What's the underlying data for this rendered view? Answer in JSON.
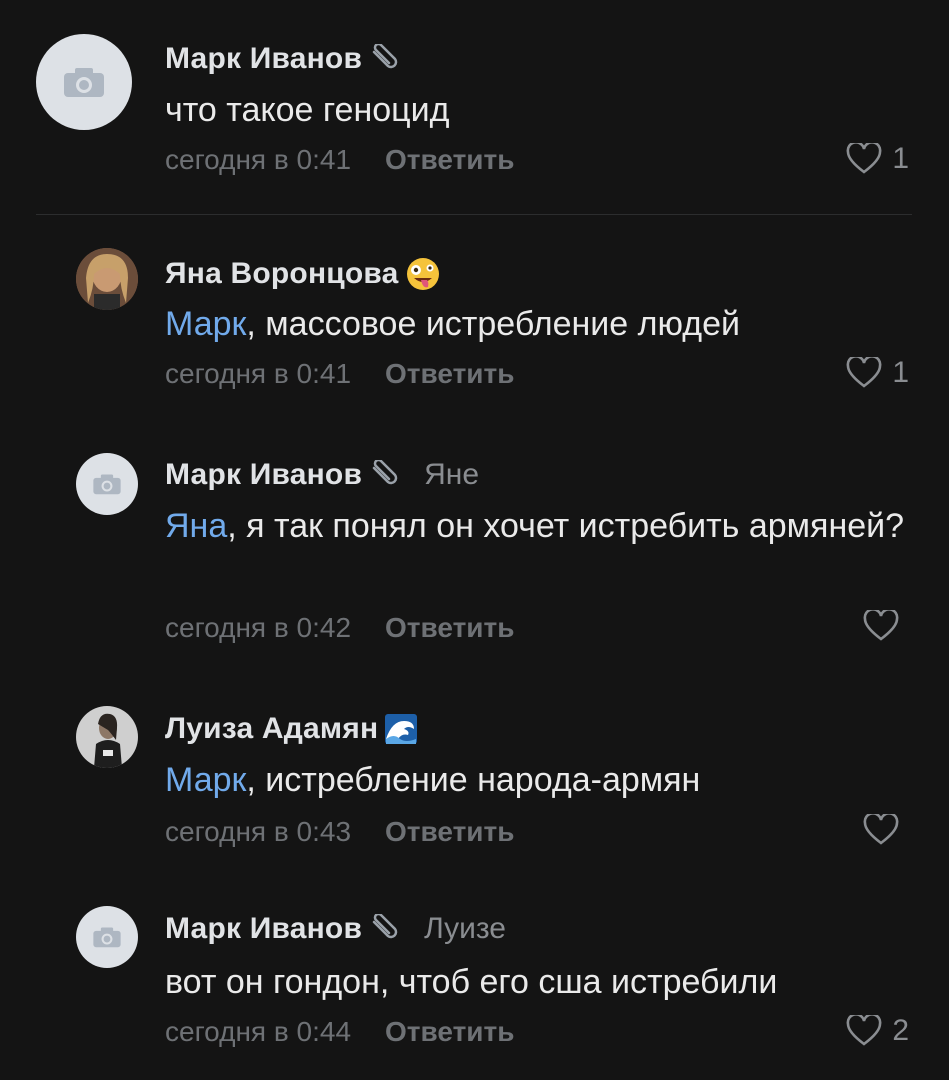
{
  "comments": [
    {
      "author": "Марк Иванов",
      "badge": "paperclip-icon",
      "reply_to": "",
      "mention": "",
      "text": "что такое геноцид",
      "time": "сегодня в 0:41",
      "reply_label": "Ответить",
      "likes": "1"
    },
    {
      "author": "Яна Воронцова",
      "badge": "zany-face-emoji",
      "reply_to": "",
      "mention": "Марк",
      "text": ", массовое истребление людей",
      "time": "сегодня в 0:41",
      "reply_label": "Ответить",
      "likes": "1"
    },
    {
      "author": "Марк Иванов",
      "badge": "paperclip-icon",
      "reply_to": "Яне",
      "mention": "Яна",
      "text": ", я так понял он хочет истребить армяней?",
      "time": "сегодня в 0:42",
      "reply_label": "Ответить",
      "likes": ""
    },
    {
      "author": "Луиза Адамян",
      "badge": "wave-emoji",
      "reply_to": "",
      "mention": "Марк",
      "text": ", истребление народа-армян",
      "time": "сегодня в 0:43",
      "reply_label": "Ответить",
      "likes": ""
    },
    {
      "author": "Марк Иванов",
      "badge": "paperclip-icon",
      "reply_to": "Луизе",
      "mention": "",
      "text": "вот он гондон, чтоб его сша истребили",
      "time": "сегодня в 0:44",
      "reply_label": "Ответить",
      "likes": "2"
    }
  ],
  "colors": {
    "background": "#141414",
    "mention": "#71aaeb",
    "meta": "#6e7175",
    "placeholder_avatar": "#dde1e6"
  }
}
